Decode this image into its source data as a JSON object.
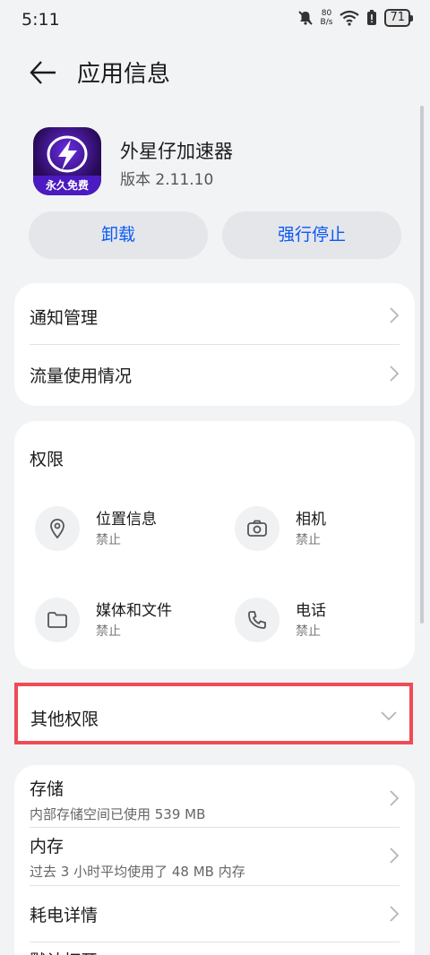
{
  "status_bar": {
    "time": "5:11",
    "net_speed_value": "80",
    "net_speed_unit": "B/s",
    "battery": "71"
  },
  "header": {
    "title": "应用信息"
  },
  "app": {
    "name": "外星仔加速器",
    "version": "版本 2.11.10",
    "icon_label": "永久免费"
  },
  "actions": {
    "uninstall": "卸载",
    "force_stop": "强行停止"
  },
  "settings_top": [
    {
      "label": "通知管理"
    },
    {
      "label": "流量使用情况"
    }
  ],
  "permissions": {
    "title": "权限",
    "items": [
      {
        "name": "位置信息",
        "state": "禁止",
        "icon": "location-icon"
      },
      {
        "name": "相机",
        "state": "禁止",
        "icon": "camera-icon"
      },
      {
        "name": "媒体和文件",
        "state": "禁止",
        "icon": "folder-icon"
      },
      {
        "name": "电话",
        "state": "禁止",
        "icon": "phone-icon"
      }
    ]
  },
  "other_permissions": {
    "label": "其他权限"
  },
  "details": [
    {
      "label": "存储",
      "sub": "内部存储空间已使用 539 MB"
    },
    {
      "label": "内存",
      "sub": "过去 3 小时平均使用了 48 MB 内存"
    },
    {
      "label": "耗电详情"
    },
    {
      "label": "默认打开"
    }
  ],
  "colors": {
    "accent": "#0a59f7",
    "highlight": "#ef4b55",
    "background": "#f1f3f5"
  }
}
